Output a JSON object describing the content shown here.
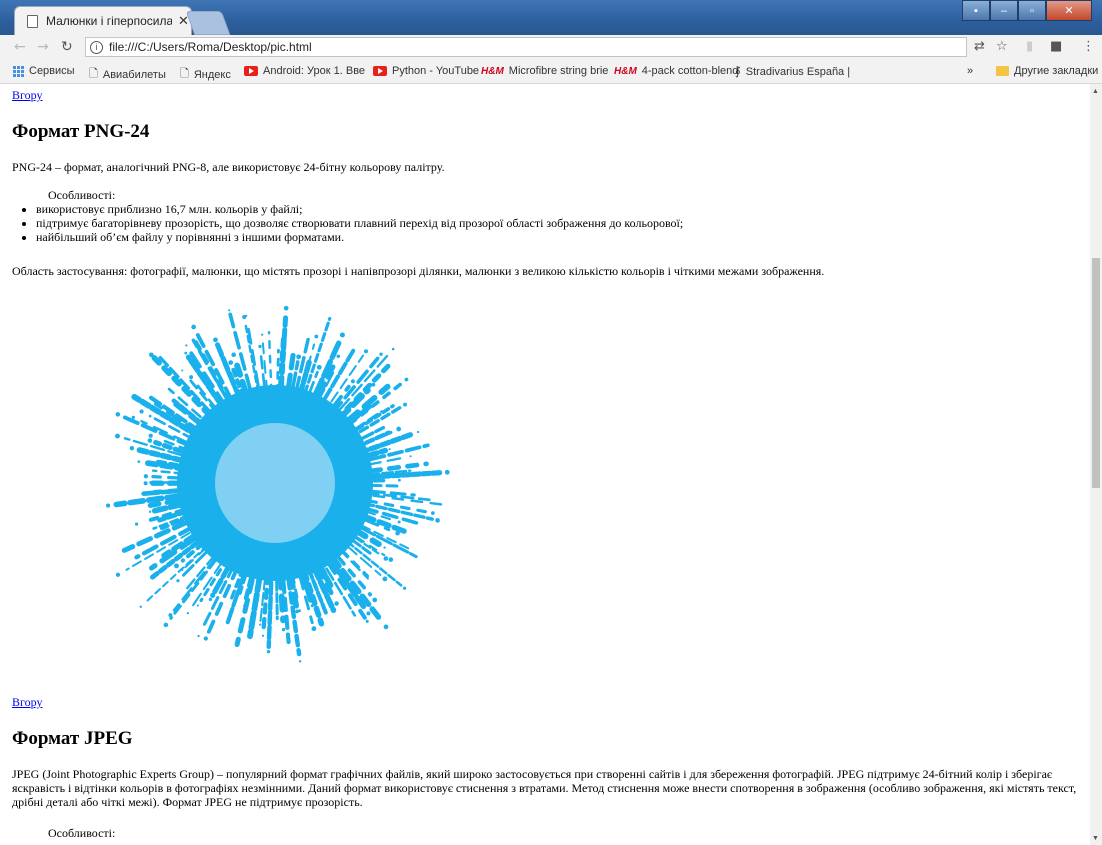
{
  "tab": {
    "title": "Малюнки і гіперпосилан"
  },
  "toolbar": {
    "url": "file:///C:/Users/Roma/Desktop/pic.html"
  },
  "bookmarks": {
    "items": [
      "Сервисы",
      "Авиабилеты",
      "Яндекс",
      "Android: Урок 1. Вве",
      "Python - YouTube",
      "Microfibre string brie",
      "4-pack cotton-blend",
      "Stradivarius España |"
    ],
    "more": "»",
    "other": "Другие закладки"
  },
  "page": {
    "link_top": "Вгору",
    "h_png24": "Формат PNG-24",
    "p_png24": "PNG-24 – формат, аналогічний PNG-8, але використовує 24-бітну кольорову палітру.",
    "features_label": "Особливості:",
    "png24_features": [
      "використовує приблизно 16,7 млн. кольорів у файлі;",
      "підтримує багаторівневу прозорість, що дозволяє створювати плавний перехід від прозорої області зображення до кольорової;",
      "найбільший об’єм файлу у порівнянні з іншими форматами."
    ],
    "usage": "Область застосування: фотографії, малюнки, що містять прозорі і напівпрозорі ділянки, малюнки з великою кількістю кольорів і чіткими межами зображення.",
    "link_bottom": "Вгору",
    "h_jpeg": "Формат JPEG",
    "p_jpeg": "JPEG (Joint Photographic Experts Group) – популярний формат графічних файлів, який широко застосовується при створенні сайтів і для збереження фотографій. JPEG підтримує 24-бітний колір і зберігає яскравість і відтінки кольорів в фотографіях незмінними. Даний формат використовує стиснення з втратами. Метод стиснення може внести спотворення в зображення (особливо зображення, які містять текст, дрібні деталі або чіткі межі). Формат JPEG не підтримує прозорість.",
    "jpeg_features_label": "Особливості:"
  },
  "colors": {
    "splash": "#1ab0ec",
    "splash_core": "#7fd0f3",
    "link": "#0000ee"
  }
}
